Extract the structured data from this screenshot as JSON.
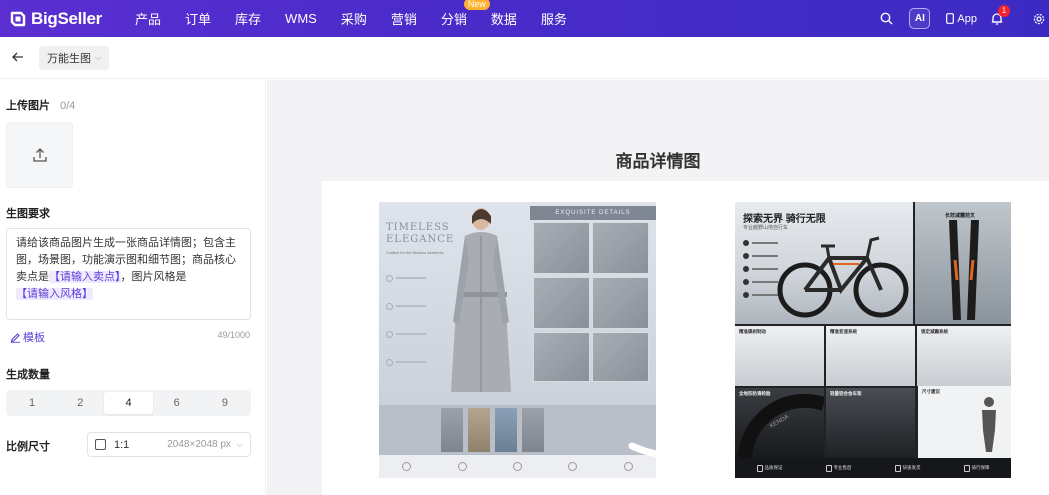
{
  "brand": {
    "name": "BigSeller"
  },
  "nav": {
    "items": [
      "产品",
      "订单",
      "库存",
      "WMS",
      "采购",
      "营销",
      "分销",
      "数据",
      "服务"
    ],
    "badge": {
      "item_index": 6,
      "text": "New"
    },
    "ai_label": "AI",
    "app_label": "App",
    "notification_count": "1"
  },
  "subbar": {
    "mode": "万能生图"
  },
  "upload": {
    "title": "上传图片",
    "count": "0/4"
  },
  "prompt": {
    "title": "生图要求",
    "text_before": "请给该商品图片生成一张商品详情图；包含主图，场景图，功能演示图和细节图；商品核心卖点是",
    "tag1": "【请输入卖点】",
    "text_mid": "，图片风格是",
    "tag2": "【请输入风格】",
    "template_label": "模板",
    "char_count": "49/1000"
  },
  "count": {
    "title": "生成数量",
    "options": [
      "1",
      "2",
      "4",
      "6",
      "9"
    ],
    "selected": "4"
  },
  "ratio": {
    "title": "比例尺寸",
    "value": "1:1",
    "dimensions": "2048×2048 px"
  },
  "preview": {
    "title": "商品详情图"
  },
  "poster1": {
    "title_line1": "TIMELESS",
    "title_line2": "ELEGANCE",
    "subtitle": "Crafted for the Modern Aesthetic",
    "detail_header": "EXQUISITE DETAILS"
  },
  "poster2": {
    "title": "探索无界 骑行无限",
    "subtitle": "专业越野山地自行车",
    "fork_label": "长效减震前叉",
    "cells": [
      "精准碟刹制动",
      "精准变速系统",
      "锁定减震系统",
      "全地形防滑轮胎",
      "轻量铝合金车架",
      "尺寸建议"
    ],
    "tyre_brand": "KENDA",
    "footer": [
      "品质保证",
      "专业售后",
      "快速发货",
      "骑行保障"
    ]
  },
  "colors": {
    "primary": "#5b3fd6",
    "nav_bg": "#4a2bc9",
    "badge": "#ffb02e",
    "alert": "#f5222d"
  }
}
